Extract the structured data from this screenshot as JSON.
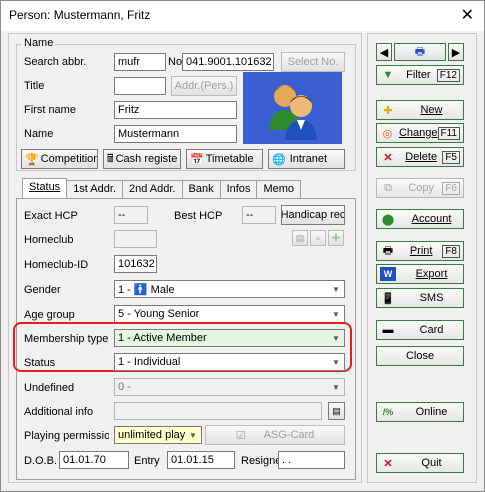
{
  "window": {
    "title": "Person: Mustermann, Fritz"
  },
  "name_section": {
    "legend": "Name",
    "search_abbr_label": "Search abbr.",
    "search_abbr_value": "mufr",
    "no_label": "No",
    "no_value": "041.9001.101632",
    "select_no_button": "Select No.",
    "title_label": "Title",
    "title_value": "",
    "addr_pers_button": "Addr.(Pers.)",
    "first_name_label": "First name",
    "first_name_value": "Fritz",
    "name_label": "Name",
    "name_value": "Mustermann"
  },
  "link_buttons": {
    "competition": "Competition",
    "cash_register": "Cash registe",
    "timetable": "Timetable",
    "intranet": "Intranet"
  },
  "tabs": [
    "Status",
    "1st Addr.",
    "2nd Addr.",
    "Bank",
    "Infos",
    "Memo"
  ],
  "status_tab": {
    "exact_hcp_label": "Exact HCP",
    "exact_hcp_value": "--",
    "best_hcp_label": "Best HCP",
    "best_hcp_value": "--",
    "handicap_button": "Handicap rec",
    "homeclub_label": "Homeclub",
    "homeclub_value": "",
    "homeclub_id_label": "Homeclub-ID",
    "homeclub_id_value": "101632",
    "gender_label": "Gender",
    "gender_value_prefix": "1 -",
    "gender_value_text": "Male",
    "age_group_label": "Age group",
    "age_group_value": "5 - Young Senior",
    "membership_type_label": "Membership type",
    "membership_type_value": "1 - Active Member",
    "status_label": "Status",
    "status_value": "1 - Individual",
    "undefined_label": "Undefined",
    "undefined_value": "0 -",
    "additional_info_label": "Additional info",
    "additional_info_value": "",
    "playing_permission_label": "Playing permissior",
    "playing_permission_value": "unlimited play",
    "asg_card_button": "ASG-Card",
    "dob_label": "D.O.B.",
    "dob_value": "01.01.70",
    "entry_label": "Entry",
    "entry_value": "01.01.15",
    "resigned_label": "Resigne",
    "resigned_value": ". ."
  },
  "right_panel": {
    "filter": {
      "label": "Filter",
      "key": "F12"
    },
    "new": {
      "label": "New"
    },
    "change": {
      "label": "Change",
      "key": "F11"
    },
    "delete": {
      "label": "Delete",
      "key": "F5"
    },
    "copy": {
      "label": "Copy",
      "key": "F6"
    },
    "account": {
      "label": "Account"
    },
    "print": {
      "label": "Print",
      "key": "F8"
    },
    "export": {
      "label": "Export"
    },
    "sms": {
      "label": "SMS"
    },
    "card": {
      "label": "Card"
    },
    "close": {
      "label": "Close"
    },
    "online": {
      "label": "Online"
    },
    "quit": {
      "label": "Quit"
    }
  },
  "colors": {
    "highlight_ring": "#e0201a",
    "button_border_green": "#3a7a3a",
    "avatar_bg": "#3a5fd0"
  }
}
